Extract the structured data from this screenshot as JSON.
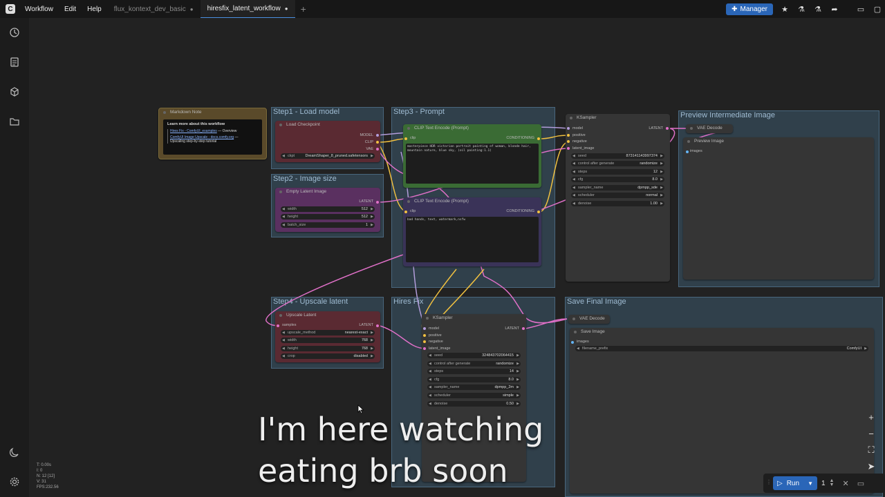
{
  "topbar": {
    "menus": [
      "Workflow",
      "Edit",
      "Help"
    ],
    "tabs": [
      {
        "label": "flux_kontext_dev_basic",
        "active": false
      },
      {
        "label": "hiresfix_latent_workflow",
        "active": true
      }
    ],
    "manager_label": "Manager"
  },
  "groups": {
    "load_model": "Step1 - Load model",
    "image_size": "Step2 - Image size",
    "prompt": "Step3 - Prompt",
    "preview": "Preview Intermediate Image",
    "upscale": "Step4 - Upscale latent",
    "hires": "Hires Fix",
    "save": "Save Final Image"
  },
  "nodes": {
    "markdown": {
      "title": "Markdown Note",
      "heading": "Learn more about this workflow",
      "link1": "Hires Fix - ComfyUI_examples",
      "link1_suffix": " — Overview",
      "link2": "ComfyUI Image Upscale - docs.comfy.org",
      "link2_suffix": " — ",
      "link2_tail": "Upscaling step-by-step tutorial"
    },
    "checkpoint": {
      "title": "Load Checkpoint",
      "out_model": "MODEL",
      "out_clip": "CLIP",
      "out_vae": "VAE",
      "w_label": "ckpt",
      "w_value": "DreamShaper_8_pruned.safetensors"
    },
    "empty_latent": {
      "title": "Empty Latent Image",
      "out": "LATENT",
      "width_label": "width",
      "width": "512",
      "height_label": "height",
      "height": "512",
      "batch_label": "batch_size",
      "batch": "1"
    },
    "clip_pos": {
      "title": "CLIP Text Encode (Prompt)",
      "in": "clip",
      "out": "CONDITIONING",
      "text": "masterpiece HDR victorian portrait painting of woman, blonde hair, mountain nature, blue sky, (oil painting:1.1)"
    },
    "clip_neg": {
      "title": "CLIP Text Encode (Prompt)",
      "in": "clip",
      "out": "CONDITIONING",
      "text": "bad hands, text, watermark,nsfw"
    },
    "ksampler1": {
      "title": "KSampler",
      "in_model": "model",
      "in_positive": "positive",
      "in_negative": "negative",
      "in_latent": "latent_image",
      "out": "LATENT",
      "widgets": [
        {
          "label": "seed",
          "value": "873141143997374"
        },
        {
          "label": "control after generate",
          "value": "randomize"
        },
        {
          "label": "steps",
          "value": "12"
        },
        {
          "label": "cfg",
          "value": "8.0"
        },
        {
          "label": "sampler_name",
          "value": "dpmpp_sde"
        },
        {
          "label": "scheduler",
          "value": "normal"
        },
        {
          "label": "denoise",
          "value": "1.00"
        }
      ]
    },
    "vae_decode1": {
      "title": "VAE Decode"
    },
    "preview": {
      "title": "Preview Image",
      "in": "images"
    },
    "upscale": {
      "title": "Upscale Latent",
      "in": "samples",
      "out": "LATENT",
      "widgets": [
        {
          "label": "upscale_method",
          "value": "nearest-exact"
        },
        {
          "label": "width",
          "value": "768"
        },
        {
          "label": "height",
          "value": "768"
        },
        {
          "label": "crop",
          "value": "disabled"
        }
      ]
    },
    "ksampler2": {
      "title": "KSampler",
      "in_model": "model",
      "in_positive": "positive",
      "in_negative": "negative",
      "in_latent": "latent_image",
      "out": "LATENT",
      "widgets": [
        {
          "label": "seed",
          "value": "324843702064415"
        },
        {
          "label": "control after generate",
          "value": "randomize"
        },
        {
          "label": "steps",
          "value": "14"
        },
        {
          "label": "cfg",
          "value": "8.0"
        },
        {
          "label": "sampler_name",
          "value": "dpmpp_2m"
        },
        {
          "label": "scheduler",
          "value": "simple"
        },
        {
          "label": "denoise",
          "value": "0.50"
        }
      ]
    },
    "vae_decode2": {
      "title": "VAE Decode"
    },
    "save": {
      "title": "Save Image",
      "in": "images",
      "w_label": "filename_prefix",
      "w_value": "ComfyUI"
    }
  },
  "overlay": {
    "line1": "I'm here watching",
    "line2": "eating brb soon"
  },
  "stats": {
    "t": "T: 0.00s",
    "i": "I: 0",
    "n": "N: 12 [12]",
    "v": "V: 31",
    "fps": "FPS:232.56"
  },
  "runbar": {
    "run_label": "Run",
    "count": "1"
  },
  "colors": {
    "accent": "#2a66b8",
    "link_pink": "#e070c8",
    "link_yellow": "#f0c040",
    "clip_green": "#3a6b34",
    "neg_purple": "#3a3358",
    "model_red": "#5a2a32",
    "latent_purple": "#5a3060"
  }
}
